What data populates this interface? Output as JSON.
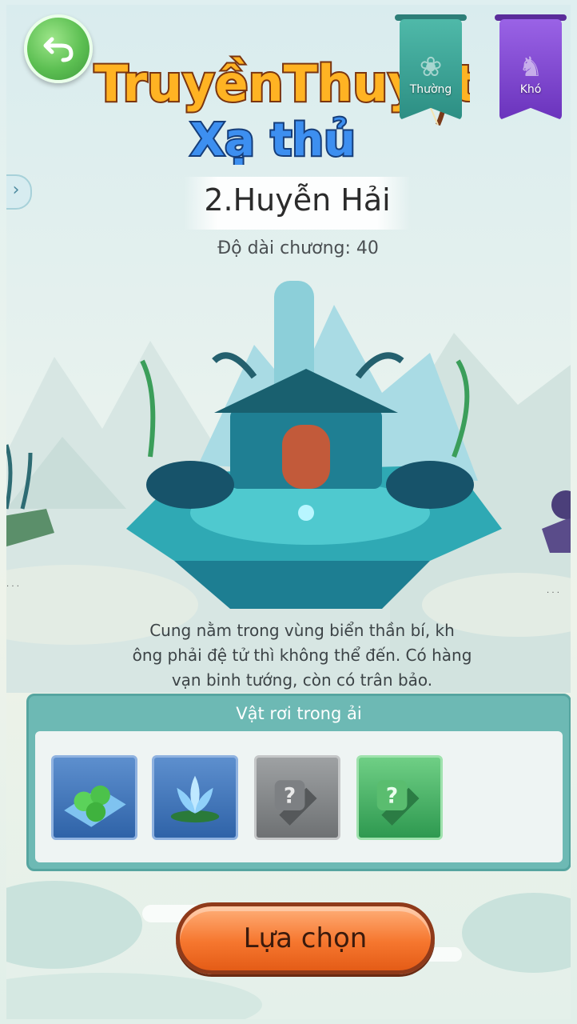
{
  "header": {
    "logo_line1": "TruyềnThuyết",
    "logo_line2": "Xạ thủ",
    "difficulty_tabs": [
      {
        "label": "Thường",
        "active": true,
        "color": "#3aa395"
      },
      {
        "label": "Khó",
        "active": false,
        "color": "#7b45cf"
      }
    ]
  },
  "chapter": {
    "title": "2.Huyễn Hải",
    "length_label": "Độ dài chương: 40"
  },
  "description": {
    "lines": [
      "Cung nằm trong vùng biển thần bí, kh",
      "ông phải đệ tử thì không thể đến. Có hàng",
      "vạn binh tướng, còn có trân bảo."
    ]
  },
  "drops": {
    "header": "Vật rơi trong ải",
    "items": [
      {
        "icon": "green-orbs-item-icon",
        "rarity": "blue"
      },
      {
        "icon": "blue-lotus-item-icon",
        "rarity": "blue"
      },
      {
        "icon": "unknown-gray-item-icon",
        "rarity": "gray",
        "mark": "?"
      },
      {
        "icon": "unknown-green-item-icon",
        "rarity": "green",
        "mark": "?"
      }
    ]
  },
  "actions": {
    "select_label": "Lựa chọn"
  },
  "colors": {
    "back_button": "#5cbf52",
    "panel": "#6db9b4",
    "select_button": "#f6772f"
  }
}
